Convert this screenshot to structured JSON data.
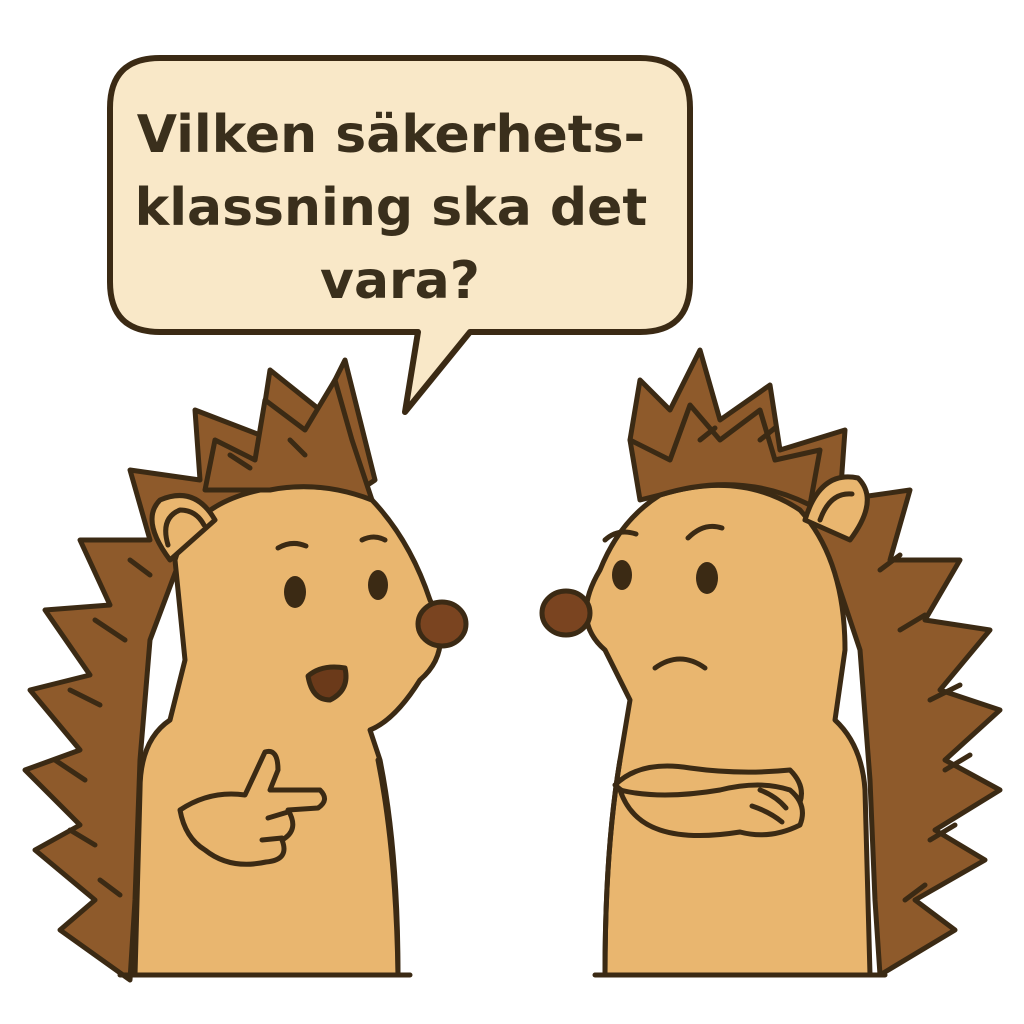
{
  "speech_bubble": {
    "lines": [
      "Vilken säkerhets-",
      "klassning ska det",
      "vara?"
    ]
  },
  "colors": {
    "outline": "#3b2a14",
    "skin": "#e9b66f",
    "spines": "#8e5a2b",
    "nose": "#7a4420",
    "bubble_fill": "#f9e8c8",
    "bubble_text": "#3a2f1c",
    "background": "#ffffff"
  },
  "characters": [
    {
      "id": "left-hedgehog",
      "pose": "pointing",
      "expression": "talking"
    },
    {
      "id": "right-hedgehog",
      "pose": "arms-crossed",
      "expression": "worried"
    }
  ]
}
